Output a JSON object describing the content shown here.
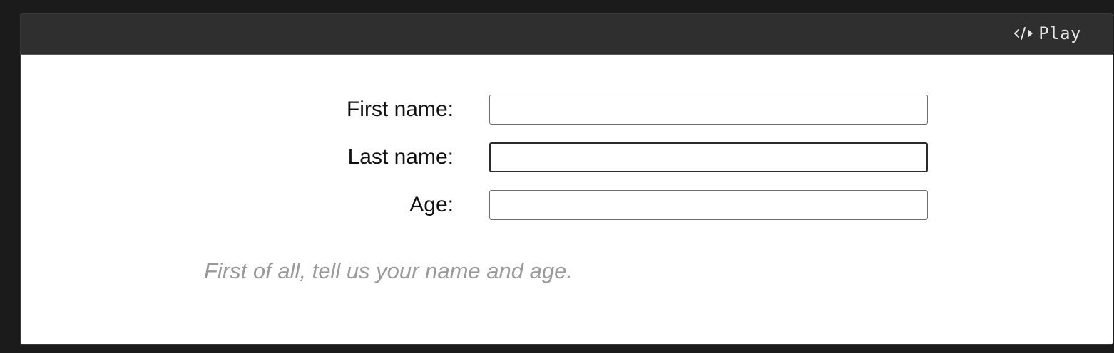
{
  "toolbar": {
    "play_label": "Play",
    "play_icon": "code-icon"
  },
  "form": {
    "fields": [
      {
        "label": "First name:",
        "value": "",
        "placeholder": ""
      },
      {
        "label": "Last name:",
        "value": "",
        "placeholder": ""
      },
      {
        "label": "Age:",
        "value": "",
        "placeholder": ""
      }
    ],
    "hint": "First of all, tell us your name and age."
  },
  "colors": {
    "background": "#1b1b1b",
    "toolbar": "#2f2f2f",
    "toolbar_text": "#e6e6e6",
    "content": "#ffffff",
    "label_text": "#111111",
    "hint_text": "#9a9a9a",
    "input_border": "#6e6e6e"
  }
}
